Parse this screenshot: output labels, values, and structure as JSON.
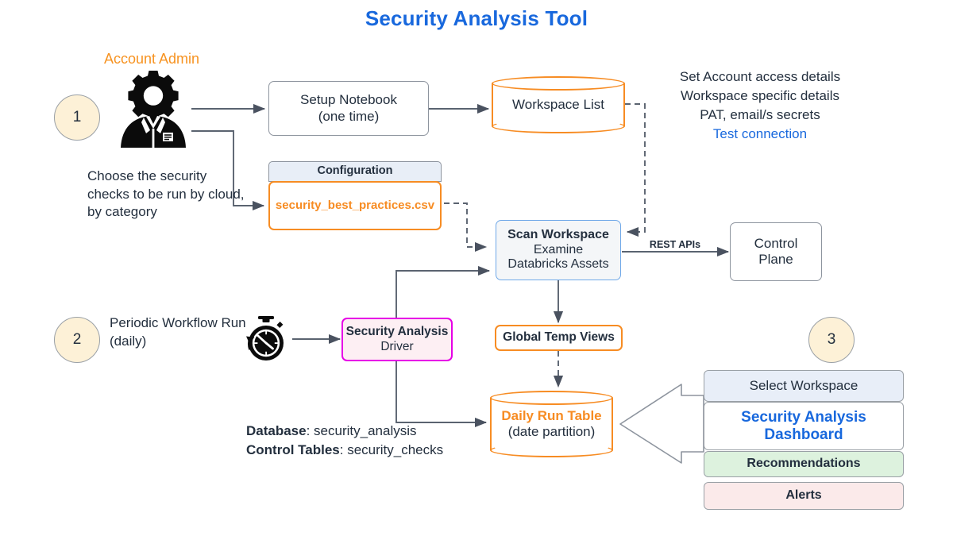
{
  "title": "Security Analysis Tool",
  "colors": {
    "title_blue": "#1868dd",
    "orange": "#f78c23",
    "magenta": "#e600e6",
    "node_blue_border": "#6fa8e8",
    "circle_fill": "#fdf1d7",
    "dash_select_fill": "#e8eef8",
    "dash_reco_fill": "#ddf2de",
    "dash_alerts_fill": "#fbeaea",
    "line_grey": "#5a6370"
  },
  "steps": {
    "one": "1",
    "two": "2",
    "three": "3"
  },
  "actors": {
    "account_admin_label": "Account Admin",
    "account_admin_icon": "gear-head-person-icon",
    "timer_icon": "stopwatch-icon"
  },
  "notes": {
    "choose_checks": "Choose the security checks to be run  by cloud, by category",
    "periodic_run": "Periodic Workflow Run (daily)",
    "set_account_lines": [
      "Set Account access details",
      "Workspace specific  details",
      "PAT, email/s secrets"
    ],
    "test_connection": "Test connection",
    "rest_apis": "REST APIs",
    "database_key": "Database",
    "database_value": ": security_analysis",
    "control_tables_key": "Control Tables",
    "control_tables_value": ": security_checks"
  },
  "nodes": {
    "setup_notebook": {
      "line1": "Setup Notebook",
      "line2": "(one time)"
    },
    "workspace_list": {
      "label": "Workspace List"
    },
    "configuration": {
      "header": "Configuration",
      "file": "security_best_practices.csv"
    },
    "scan_workspace": {
      "line1": "Scan Workspace",
      "line2": "Examine",
      "line3": "Databricks Assets"
    },
    "control_plane": {
      "line1": "Control",
      "line2": "Plane"
    },
    "security_driver": {
      "line1": "Security Analysis",
      "line2": "Driver"
    },
    "global_temp_views": {
      "label": "Global Temp Views"
    },
    "daily_run_table": {
      "line1": "Daily Run Table",
      "line2": "(date partition)"
    }
  },
  "dashboard": {
    "select_workspace": "Select Workspace",
    "dashboard_line1": "Security Analysis",
    "dashboard_line2": "Dashboard",
    "recommendations": "Recommendations",
    "alerts": "Alerts",
    "big_arrow_icon": "left-block-arrow-icon"
  }
}
